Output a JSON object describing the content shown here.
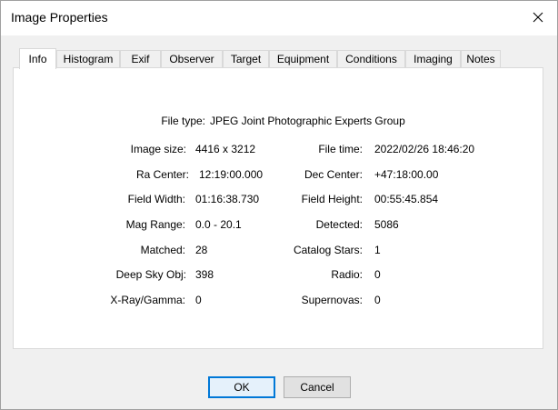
{
  "window": {
    "title": "Image Properties"
  },
  "tabs": [
    {
      "label": "Info",
      "active": true
    },
    {
      "label": "Histogram"
    },
    {
      "label": "Exif"
    },
    {
      "label": "Observer"
    },
    {
      "label": "Target"
    },
    {
      "label": "Equipment"
    },
    {
      "label": "Conditions"
    },
    {
      "label": "Imaging"
    },
    {
      "label": "Notes"
    }
  ],
  "info": {
    "file_type": {
      "label": "File type:",
      "value": "JPEG Joint Photographic Experts Group"
    },
    "image_size": {
      "label": "Image size:",
      "value": "4416 x 3212"
    },
    "file_time": {
      "label": "File time:",
      "value": "2022/02/26 18:46:20"
    },
    "ra_center": {
      "label": "Ra Center:",
      "value": "12:19:00.000"
    },
    "dec_center": {
      "label": "Dec Center:",
      "value": "+47:18:00.00"
    },
    "field_width": {
      "label": "Field Width:",
      "value": "01:16:38.730"
    },
    "field_height": {
      "label": "Field Height:",
      "value": "00:55:45.854"
    },
    "mag_range": {
      "label": "Mag Range:",
      "value": "0.0 - 20.1"
    },
    "detected": {
      "label": "Detected:",
      "value": "5086"
    },
    "matched": {
      "label": "Matched:",
      "value": "28"
    },
    "catalog_stars": {
      "label": "Catalog Stars:",
      "value": "1"
    },
    "deep_sky": {
      "label": "Deep Sky Obj:",
      "value": "398"
    },
    "radio": {
      "label": "Radio:",
      "value": "0"
    },
    "xray": {
      "label": "X-Ray/Gamma:",
      "value": "0"
    },
    "supernovas": {
      "label": "Supernovas:",
      "value": "0"
    }
  },
  "buttons": {
    "ok": "OK",
    "cancel": "Cancel"
  },
  "colors": {
    "accent": "#0078d7",
    "panel_bg": "#ffffff",
    "dialog_bg": "#f0f0f0"
  }
}
